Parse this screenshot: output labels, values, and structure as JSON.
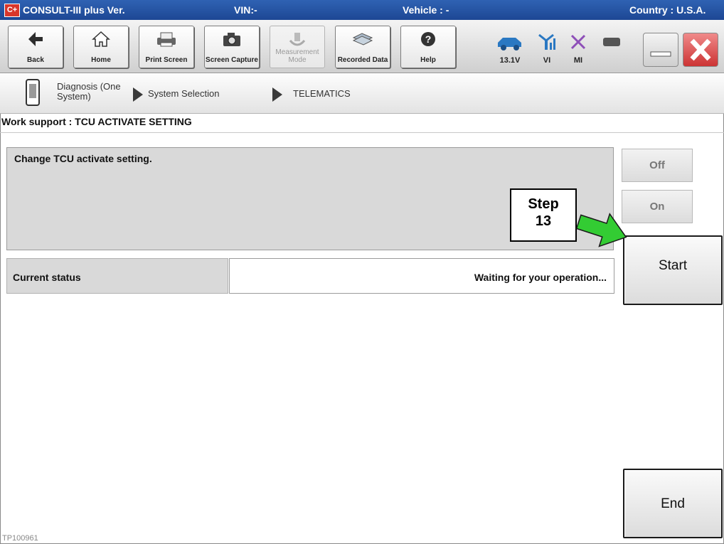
{
  "app": {
    "title": "CONSULT-III plus  Ver.",
    "vin": "VIN:-",
    "vehicle": "Vehicle : -",
    "country": "Country : U.S.A.",
    "logo_text": "C+"
  },
  "toolbar": {
    "back": "Back",
    "home": "Home",
    "print_screen": "Print Screen",
    "screen_capture": "Screen Capture",
    "measurement_mode": "Measurement Mode",
    "recorded_data": "Recorded Data",
    "help": "Help",
    "voltage": "13.1V",
    "vi": "VI",
    "mi": "MI"
  },
  "breadcrumb": {
    "item1": "Diagnosis (One System)",
    "item2": "System Selection",
    "item3": "TELEMATICS"
  },
  "work": {
    "title": "Work support : TCU ACTIVATE SETTING",
    "message": "Change TCU activate setting.",
    "status_label": "Current status",
    "status_value": "Waiting for your operation..."
  },
  "buttons": {
    "off": "Off",
    "on": "On",
    "start": "Start",
    "end": "End"
  },
  "annotation": {
    "step_line1": "Step",
    "step_line2": "13",
    "arrow_color": "#33cc33"
  },
  "footer": {
    "code": "TP100961"
  },
  "colors": {
    "titlebar": "#2354a6",
    "close_button": "#cc3333"
  }
}
